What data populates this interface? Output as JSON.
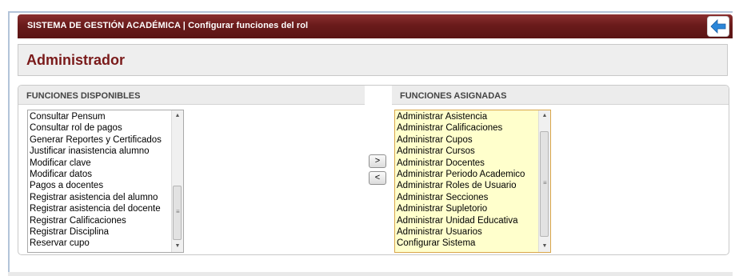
{
  "header": {
    "title": "SISTEMA DE GESTIÓN ACADÉMICA | Configurar funciones del rol",
    "back_icon": "arrow-left-icon",
    "accent": "#6a1b1b"
  },
  "role": {
    "name": "Administrador"
  },
  "available": {
    "heading": "FUNCIONES DISPONIBLES",
    "items": [
      "Consultar Pensum",
      "Consultar rol de pagos",
      "Generar Reportes y Certificados",
      "Justificar inasistencia alumno",
      "Modificar clave",
      "Modificar datos",
      "Pagos a docentes",
      "Registrar asistencia del alumno",
      "Registrar asistencia del docente",
      "Registrar Calificaciones",
      "Registrar Disciplina",
      "Reservar cupo"
    ]
  },
  "actions": {
    "add_label": ">",
    "remove_label": "<"
  },
  "assigned": {
    "heading": "FUNCIONES ASIGNADAS",
    "items": [
      "Administrar Asistencia",
      "Administrar Calificaciones",
      "Administrar Cupos",
      "Administrar Cursos",
      "Administrar Docentes",
      "Administrar Periodo Academico",
      "Administrar Roles de Usuario",
      "Administrar Secciones",
      "Administrar Supletorio",
      "Administrar Unidad Educativa",
      "Administrar Usuarios",
      "Configurar Sistema"
    ]
  },
  "colors": {
    "assigned_bg": "#ffffcc",
    "assigned_border": "#d9a64a",
    "role_name": "#7a1a1a"
  }
}
